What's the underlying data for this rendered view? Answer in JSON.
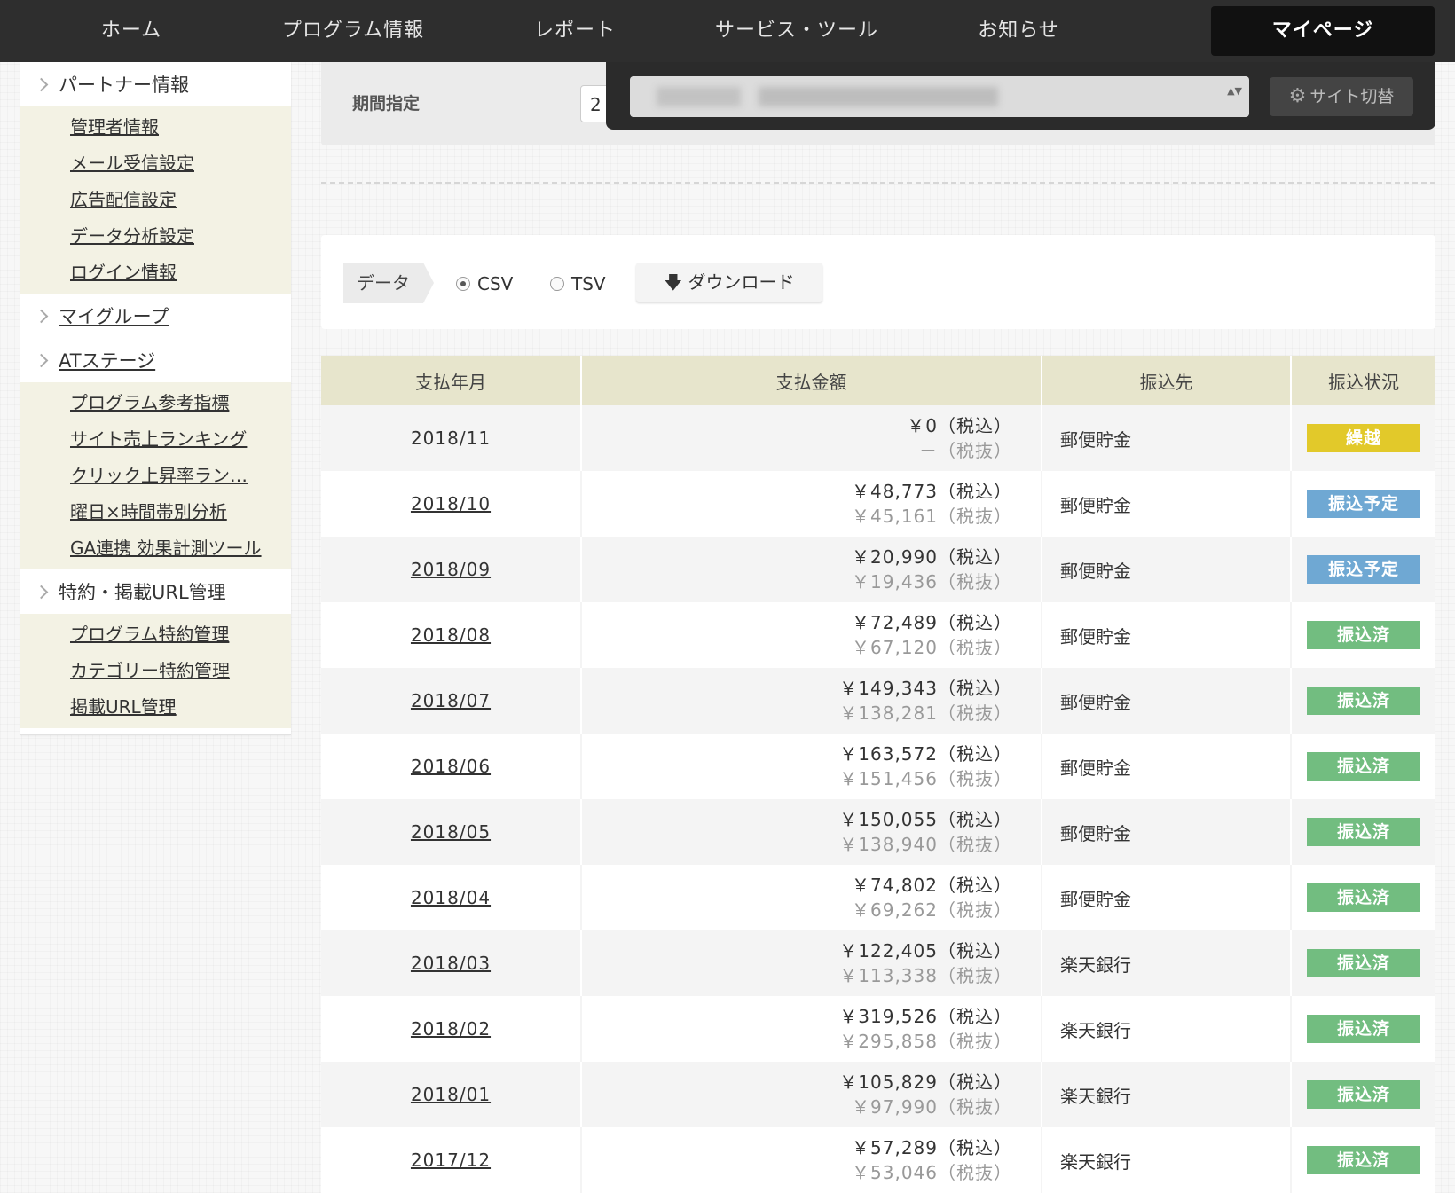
{
  "nav": {
    "items": [
      "ホーム",
      "プログラム情報",
      "レポート",
      "サービス・ツール",
      "お知らせ"
    ],
    "active": "マイページ"
  },
  "sidebar": {
    "sections": [
      {
        "label": "パートナー情報",
        "link": false,
        "items": [
          "管理者情報",
          "メール受信設定",
          "広告配信設定",
          "データ分析設定",
          "ログイン情報"
        ]
      },
      {
        "label": "マイグループ",
        "link": true,
        "items": []
      },
      {
        "label": "ATステージ",
        "link": true,
        "items": [
          "プログラム参考指標",
          "サイト売上ランキング",
          "クリック上昇率ラン…",
          "曜日×時間帯別分析",
          "GA連携 効果計測ツール"
        ]
      },
      {
        "label": "特約・掲載URL管理",
        "link": false,
        "items": [
          "プログラム特約管理",
          "カテゴリー特約管理",
          "掲載URL管理"
        ]
      }
    ]
  },
  "period": {
    "label": "期間指定",
    "value": "2"
  },
  "site_switch": {
    "button": "サイト切替",
    "arrows": "▲▼"
  },
  "download": {
    "data_label": "データ",
    "csv": "CSV",
    "tsv": "TSV",
    "button": "ダウンロード",
    "selected": "CSV"
  },
  "table": {
    "headers": [
      "支払年月",
      "支払金額",
      "振込先",
      "振込状況"
    ],
    "rows": [
      {
        "month": "2018/11",
        "link": false,
        "inc": "￥0（税込）",
        "exc": "－（税抜）",
        "bank": "郵便貯金",
        "status": "繰越",
        "color": "#e2c92a"
      },
      {
        "month": "2018/10",
        "link": true,
        "inc": "￥48,773（税込）",
        "exc": "￥45,161（税抜）",
        "bank": "郵便貯金",
        "status": "振込予定",
        "color": "#6fa8d3"
      },
      {
        "month": "2018/09",
        "link": true,
        "inc": "￥20,990（税込）",
        "exc": "￥19,436（税抜）",
        "bank": "郵便貯金",
        "status": "振込予定",
        "color": "#6fa8d3"
      },
      {
        "month": "2018/08",
        "link": true,
        "inc": "￥72,489（税込）",
        "exc": "￥67,120（税抜）",
        "bank": "郵便貯金",
        "status": "振込済",
        "color": "#72bd80"
      },
      {
        "month": "2018/07",
        "link": true,
        "inc": "￥149,343（税込）",
        "exc": "￥138,281（税抜）",
        "bank": "郵便貯金",
        "status": "振込済",
        "color": "#72bd80"
      },
      {
        "month": "2018/06",
        "link": true,
        "inc": "￥163,572（税込）",
        "exc": "￥151,456（税抜）",
        "bank": "郵便貯金",
        "status": "振込済",
        "color": "#72bd80"
      },
      {
        "month": "2018/05",
        "link": true,
        "inc": "￥150,055（税込）",
        "exc": "￥138,940（税抜）",
        "bank": "郵便貯金",
        "status": "振込済",
        "color": "#72bd80"
      },
      {
        "month": "2018/04",
        "link": true,
        "inc": "￥74,802（税込）",
        "exc": "￥69,262（税抜）",
        "bank": "郵便貯金",
        "status": "振込済",
        "color": "#72bd80"
      },
      {
        "month": "2018/03",
        "link": true,
        "inc": "￥122,405（税込）",
        "exc": "￥113,338（税抜）",
        "bank": "楽天銀行",
        "status": "振込済",
        "color": "#72bd80"
      },
      {
        "month": "2018/02",
        "link": true,
        "inc": "￥319,526（税込）",
        "exc": "￥295,858（税抜）",
        "bank": "楽天銀行",
        "status": "振込済",
        "color": "#72bd80"
      },
      {
        "month": "2018/01",
        "link": true,
        "inc": "￥105,829（税込）",
        "exc": "￥97,990（税抜）",
        "bank": "楽天銀行",
        "status": "振込済",
        "color": "#72bd80"
      },
      {
        "month": "2017/12",
        "link": true,
        "inc": "￥57,289（税込）",
        "exc": "￥53,046（税抜）",
        "bank": "楽天銀行",
        "status": "振込済",
        "color": "#72bd80"
      }
    ]
  }
}
